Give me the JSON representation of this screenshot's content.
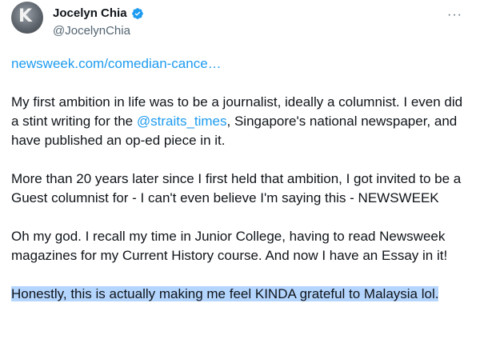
{
  "author": {
    "display_name": "Jocelyn Chia",
    "handle": "@JocelynChia",
    "avatar_glyph": "K",
    "verified_color": "#1d9bf0"
  },
  "menu": {
    "more_label": "···"
  },
  "tweet": {
    "link_text": "newsweek.com/comedian-cance…",
    "p1_before": "My first ambition in life was to be a journalist, ideally a columnist.  I even did a stint writing for the ",
    "p1_mention": "@straits_times",
    "p1_after": ", Singapore's national newspaper, and have published an op-ed piece in it.",
    "p2": "More than 20 years later since I first held that ambition, I got invited to be a Guest columnist for - I can't even believe I'm saying this - NEWSWEEK",
    "p3": "Oh my god.  I recall my time in Junior College, having to read Newsweek magazines for my Current History course.  And now I have an Essay in it!",
    "p4": "Honestly, this is actually making me feel KINDA grateful to Malaysia lol."
  }
}
